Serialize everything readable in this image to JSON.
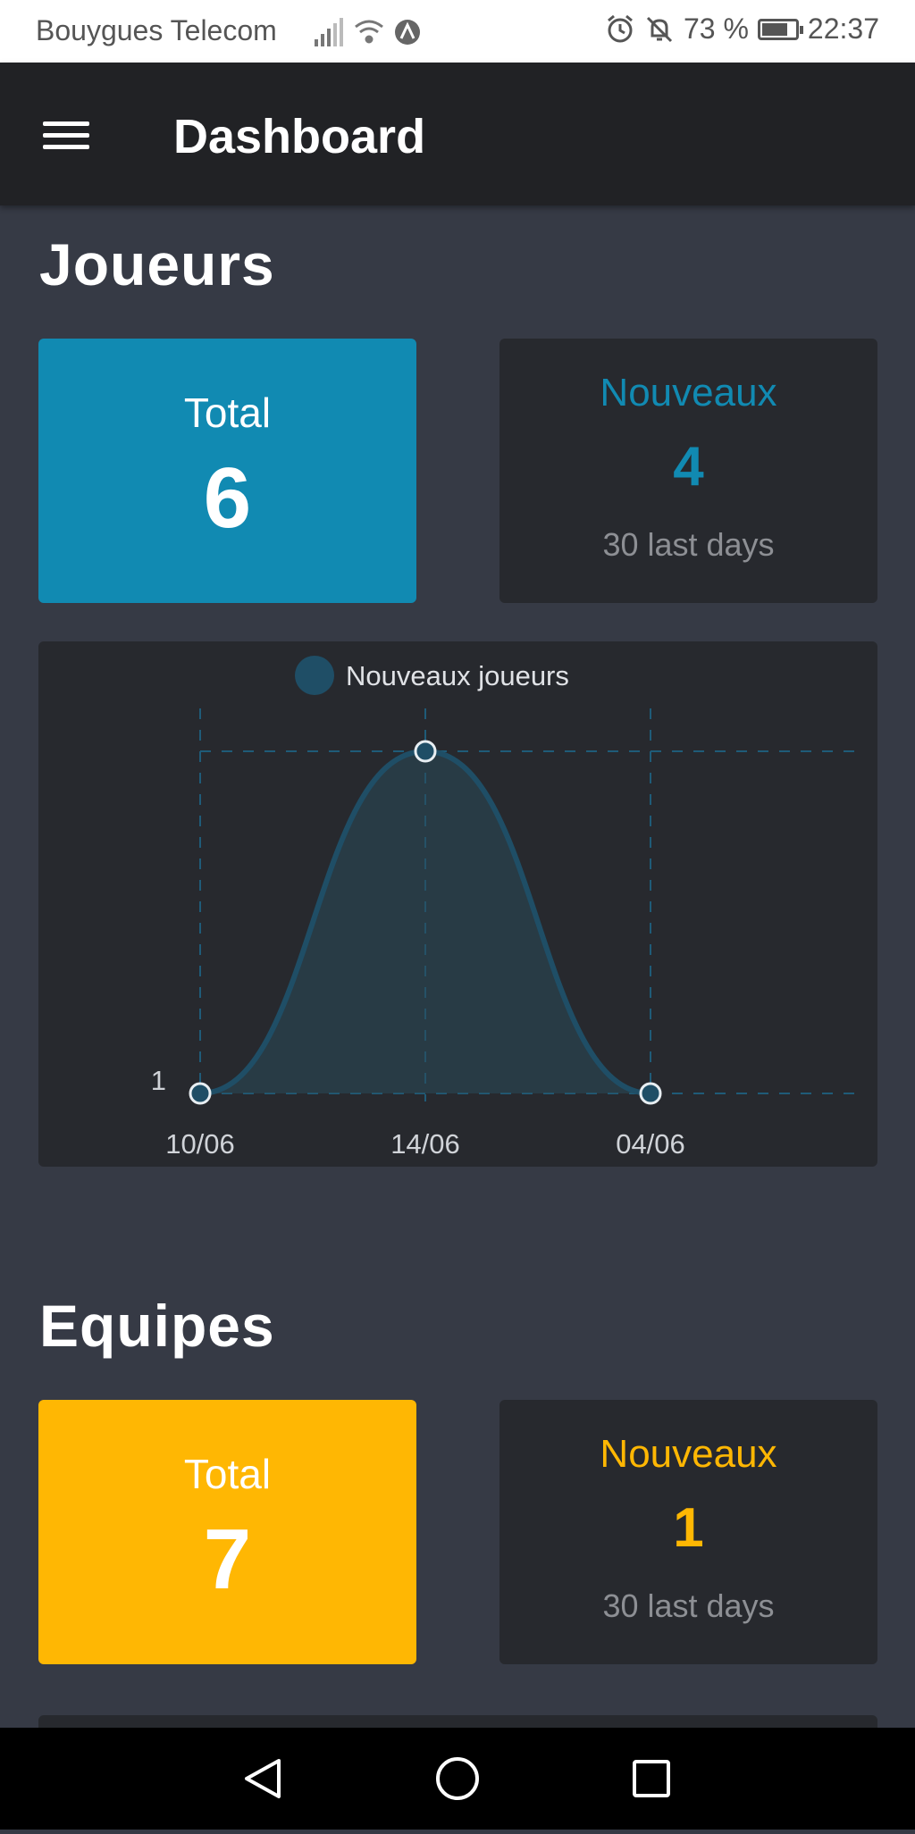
{
  "status_bar": {
    "carrier": "Bouygues Telecom",
    "battery": "73 %",
    "time": "22:37"
  },
  "app_bar": {
    "title": "Dashboard"
  },
  "joueurs": {
    "title": "Joueurs",
    "total_label": "Total",
    "total_value": "6",
    "new_label": "Nouveaux",
    "new_value": "4",
    "new_sub": "30 last days",
    "accent": "#118ab2"
  },
  "equipes": {
    "title": "Equipes",
    "total_label": "Total",
    "total_value": "7",
    "new_label": "Nouveaux",
    "new_value": "1",
    "new_sub": "30 last days",
    "accent": "#ffb703"
  },
  "chart_data": {
    "type": "area",
    "categories": [
      "10/06",
      "14/06",
      "04/06"
    ],
    "series": [
      {
        "name": "Nouveaux joueurs",
        "values": [
          1,
          2,
          1
        ],
        "color": "#1f4e66"
      }
    ],
    "yticks": [
      "1"
    ],
    "grid": true,
    "legend": "top-center"
  },
  "icons": {
    "menu": "hamburger-icon",
    "back": "back-triangle-icon",
    "home": "home-circle-icon",
    "recents": "recents-square-icon"
  }
}
